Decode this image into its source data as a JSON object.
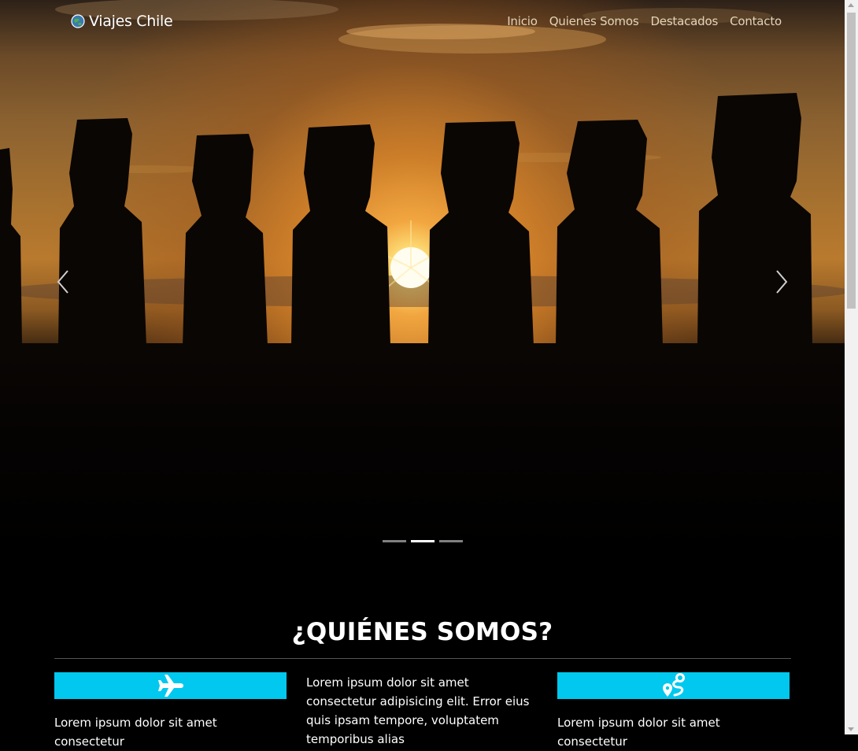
{
  "navbar": {
    "brand": "Viajes Chile",
    "links": [
      "Inicio",
      "Quienes Somos",
      "Destacados",
      "Contacto"
    ]
  },
  "carousel": {
    "slide_image": "moai-sunset-photo",
    "indicators": 3,
    "active_indicator": 2
  },
  "about": {
    "title": "¿QUIÉNES SOMOS?",
    "columns": [
      {
        "icon": "airplane-icon",
        "text": "Lorem ipsum dolor sit amet consectetur"
      },
      {
        "icon": "",
        "text": "Lorem ipsum dolor sit amet consectetur adipisicing elit. Error eius quis ipsam tempore, voluptatem temporibus alias"
      },
      {
        "icon": "route-icon",
        "text": "Lorem ipsum dolor sit amet consectetur"
      }
    ]
  },
  "colors": {
    "accent": "#00c8ee",
    "background": "#000000"
  }
}
